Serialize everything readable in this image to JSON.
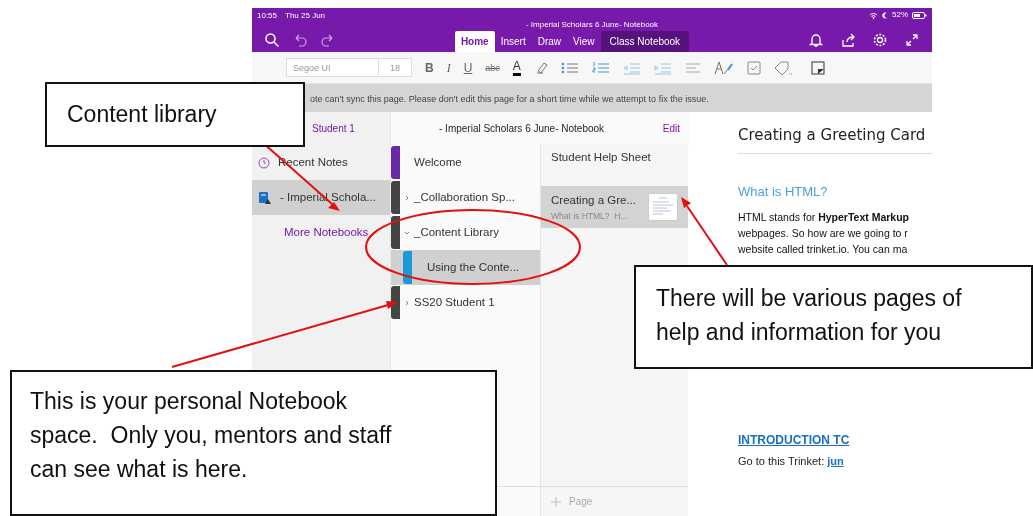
{
  "status_bar": {
    "time": "10:55",
    "date": "Thu 25 Jun",
    "battery": "52%"
  },
  "window": {
    "title": "- Imperial Scholars 6 June- Notebook"
  },
  "tabs": [
    {
      "label": "Home",
      "selected": true,
      "kind": "ribbon"
    },
    {
      "label": "Insert",
      "selected": false,
      "kind": "ribbon"
    },
    {
      "label": "Draw",
      "selected": false,
      "kind": "ribbon"
    },
    {
      "label": "View",
      "selected": false,
      "kind": "ribbon"
    },
    {
      "label": "Class Notebook",
      "selected": false,
      "kind": "addin"
    }
  ],
  "format_toolbar": {
    "font": "Segoe UI",
    "size": "18",
    "text_buttons": [
      "B",
      "I",
      "U",
      "abc",
      "A"
    ]
  },
  "warning": "ote can't sync this page. Please don't edit this page for a short time while we attempt to fix the issue.",
  "notebooks": {
    "header": "Student 1",
    "items": [
      {
        "kind": "recent",
        "label": "Recent Notes",
        "selected": false
      },
      {
        "kind": "notebook",
        "label": "- Imperial Schola...",
        "selected": true
      },
      {
        "kind": "more",
        "label": "More Notebooks",
        "selected": false
      }
    ]
  },
  "sections": {
    "header": "- Imperial Scholars 6 June- Notebook",
    "edit": "Edit",
    "items": [
      {
        "kind": "section",
        "label": "Welcome",
        "color": "#6a2aa6",
        "selected": false
      },
      {
        "kind": "group",
        "label": "_Collaboration Sp...",
        "color": "#454545",
        "expanded": false,
        "selected": false
      },
      {
        "kind": "group",
        "label": "_Content Library",
        "color": "#454545",
        "expanded": true,
        "selected": false,
        "children": [
          {
            "kind": "section",
            "label": "Using the Conte...",
            "color": "#1b9ad8",
            "selected": true
          }
        ]
      },
      {
        "kind": "group",
        "label": "SS20 Student 1",
        "color": "#454545",
        "expanded": false,
        "selected": false
      }
    ]
  },
  "pages": {
    "items": [
      {
        "title": "Student Help Sheet",
        "selected": false
      },
      {
        "title": "Creating a Gre...",
        "preview": "What is HTML?  H...",
        "selected": true
      }
    ],
    "add": "Page"
  },
  "note": {
    "title": "Creating a Greeting Card",
    "heading": "What is HTML?",
    "paragraph_lines": [
      "HTML stands for **HyperText Markup**",
      "webpages. So how are we going to r",
      "website called trinket.io. You can ma"
    ],
    "link": "INTRODUCTION TC",
    "trinket_label": "Go to this Trinket:",
    "trinket_link": "jun"
  },
  "annotations": [
    {
      "kind": "callout",
      "text": "Content library"
    },
    {
      "kind": "callout",
      "text": "This is your personal Notebook space.  Only you, mentors and staff can see what is here."
    },
    {
      "kind": "callout",
      "text": "There will be various pages of help and information for you"
    }
  ]
}
